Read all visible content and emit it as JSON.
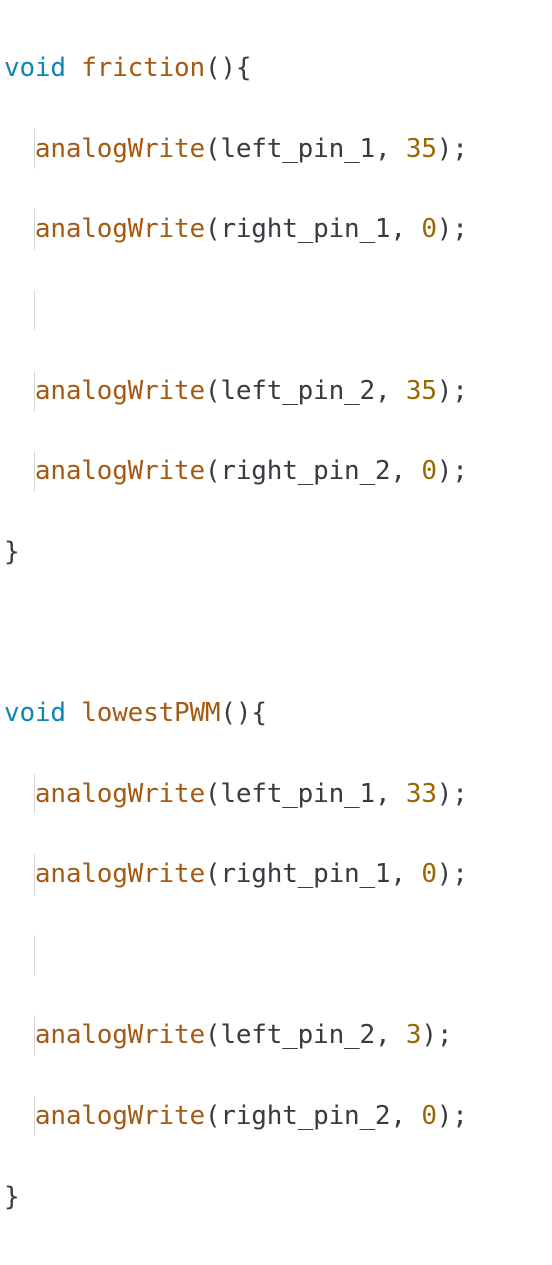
{
  "code": {
    "func1": {
      "returnType": "void",
      "name": "friction",
      "body": [
        {
          "call": "analogWrite",
          "arg1": "left_pin_1",
          "arg2": "35"
        },
        {
          "call": "analogWrite",
          "arg1": "right_pin_1",
          "arg2": "0"
        },
        {
          "blank": true
        },
        {
          "call": "analogWrite",
          "arg1": "left_pin_2",
          "arg2": "35"
        },
        {
          "call": "analogWrite",
          "arg1": "right_pin_2",
          "arg2": "0"
        }
      ]
    },
    "func2": {
      "returnType": "void",
      "name": "lowestPWM",
      "body": [
        {
          "call": "analogWrite",
          "arg1": "left_pin_1",
          "arg2": "33"
        },
        {
          "call": "analogWrite",
          "arg1": "right_pin_1",
          "arg2": "0"
        },
        {
          "blank": true
        },
        {
          "call": "analogWrite",
          "arg1": "left_pin_2",
          "arg2": "3"
        },
        {
          "call": "analogWrite",
          "arg1": "right_pin_2",
          "arg2": "0"
        }
      ]
    }
  }
}
